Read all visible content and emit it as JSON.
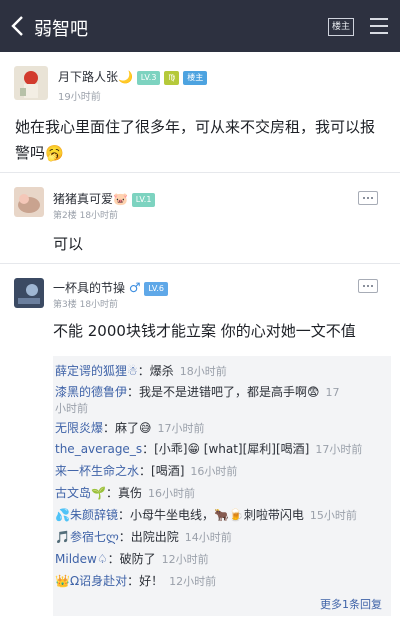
{
  "topbar": {
    "title": "弱智吧",
    "louzhu_label": "楼主"
  },
  "op": {
    "username": "月下路人张🌙",
    "level": "LV.3",
    "zodiac": "♍",
    "role_badge": "楼主",
    "time": "19小时前",
    "content": "她在我心里面住了很多年，可从来不交房租，我可以报警吗🥱"
  },
  "floors": [
    {
      "username": "猪猪真可爱🐷",
      "level": "LV.1",
      "meta": "第2楼  18小时前",
      "text": "可以"
    },
    {
      "username": "一杯具的节操",
      "gender": "♂",
      "level": "LV.6",
      "meta": "第3楼  18小时前",
      "text": "不能 2000块钱才能立案 你的心对她一文不值"
    }
  ],
  "replies": [
    {
      "name": "薛定谔的狐狸☃",
      "text": "：爆杀",
      "time": "18小时前"
    },
    {
      "name": "漆黑的德鲁伊",
      "text": "：我是不是进错吧了，都是高手啊😨",
      "time": "17",
      "time2": "小时前"
    },
    {
      "name": "无限炎爆",
      "text": "：麻了😅",
      "time": "17小时前"
    },
    {
      "name": "the_average_s",
      "text": "：[小乖]😁 [what][犀利][喝酒]",
      "time": "17小时前"
    },
    {
      "name": "来一杯生命之水",
      "text": "：[喝酒]",
      "time": "16小时前"
    },
    {
      "name": "古文岛🌱",
      "text": "：真伤",
      "time": "16小时前"
    },
    {
      "name": "💦朱颜辞镜",
      "text": "：小母牛坐电线，🐂🍺刺啦带闪电",
      "time": "15小时前"
    },
    {
      "name": "🎵参宿七ლ",
      "text": "：出院出院",
      "time": "14小时前"
    },
    {
      "name": "Mildew♤",
      "text": "：破防了",
      "time": "12小时前"
    },
    {
      "name": "👑Ω诏身赴对",
      "text": "：好！",
      "time": "12小时前"
    }
  ],
  "more_replies": "更多1条回复",
  "colors": {
    "topbar": "#2d3140",
    "link": "#3f63a8",
    "lv_green": "#7dd3c0",
    "lv_blue": "#5fa8e8",
    "role_badge": "#4da3e0"
  }
}
